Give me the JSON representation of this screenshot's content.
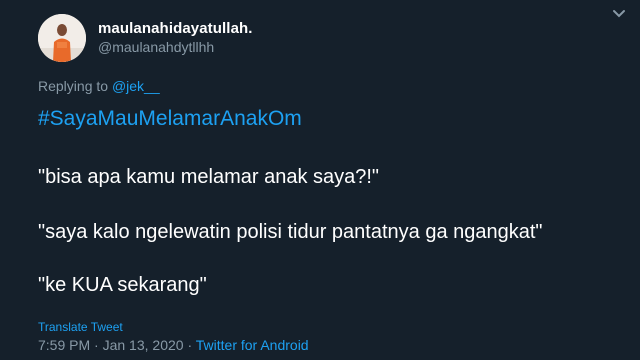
{
  "tweet": {
    "display_name": "maulanahidayatullah.",
    "handle": "@maulanahdytllhh",
    "replying_to_label": "Replying to",
    "replying_to_handle": "@jek__",
    "hashtag": "#SayaMauMelamarAnakOm",
    "lines": [
      "\"bisa apa kamu melamar anak saya?!\"",
      "\"saya kalo ngelewatin polisi tidur pantatnya ga ngangkat\"",
      "\"ke KUA sekarang\""
    ],
    "translate_label": "Translate Tweet",
    "time": "7:59 PM",
    "separator": "·",
    "date": "Jan 13, 2020",
    "source": "Twitter for Android"
  },
  "colors": {
    "background": "#15202b",
    "accent": "#1da1f2",
    "secondary_text": "#8899a6",
    "primary_text": "#ffffff"
  },
  "icons": {
    "more": "chevron-down-icon",
    "avatar": "profile-photo"
  }
}
